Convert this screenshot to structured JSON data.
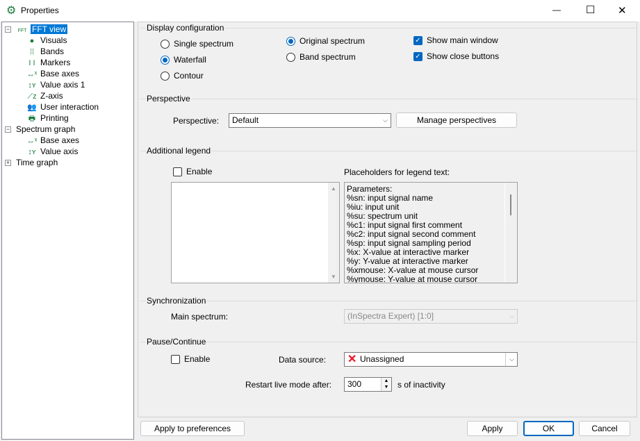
{
  "window": {
    "title": "Properties",
    "minimize": "—",
    "maximize": "☐",
    "close": "✕"
  },
  "tree": [
    {
      "label": "FFT view",
      "icon": "FFT",
      "level": 0,
      "expander": "−",
      "selected": true
    },
    {
      "label": "Visuals",
      "icon": "●",
      "level": 1
    },
    {
      "label": "Bands",
      "icon": "⁞⁞",
      "level": 1
    },
    {
      "label": "Markers",
      "icon": "I I",
      "level": 1
    },
    {
      "label": "Base axes",
      "icon": "↔ˣ",
      "level": 1
    },
    {
      "label": "Value axis 1",
      "icon": "↕ʏ",
      "level": 1
    },
    {
      "label": "Z-axis",
      "icon": "⟋z",
      "level": 1
    },
    {
      "label": "User interaction",
      "icon": "👥",
      "level": 1
    },
    {
      "label": "Printing",
      "icon": "🖶",
      "level": 1
    },
    {
      "label": "Spectrum graph",
      "level": 0,
      "expander": "−"
    },
    {
      "label": "Base axes",
      "icon": "↔ˣ",
      "level": 1
    },
    {
      "label": "Value axis",
      "icon": "↕ʏ",
      "level": 1
    },
    {
      "label": "Time graph",
      "level": 0,
      "expander": "+"
    }
  ],
  "display": {
    "title": "Display configuration",
    "single": "Single spectrum",
    "waterfall": "Waterfall",
    "contour": "Contour",
    "original": "Original spectrum",
    "band": "Band spectrum",
    "show_main": "Show main window",
    "show_close": "Show close buttons",
    "check": "✓"
  },
  "perspective": {
    "title": "Perspective",
    "label": "Perspective:",
    "value": "Default",
    "manage": "Manage perspectives"
  },
  "legend": {
    "title": "Additional legend",
    "enable": "Enable",
    "placeholders_label": "Placeholders for legend text:",
    "placeholders": [
      "Parameters:",
      "%sn: input signal name",
      "%iu: input unit",
      "%su: spectrum unit",
      "%c1: input signal first comment",
      "%c2: input signal second comment",
      "%sp: input signal sampling period",
      "%x: X-value at interactive marker",
      "%y: Y-value at interactive marker",
      "%xmouse: X-value at mouse cursor",
      "%ymouse: Y-value at mouse cursor"
    ]
  },
  "sync": {
    "title": "Synchronization",
    "label": "Main spectrum:",
    "value": "(InSpectra Expert) [1:0]"
  },
  "pause": {
    "title": "Pause/Continue",
    "enable": "Enable",
    "source_label": "Data source:",
    "source_value": "Unassigned",
    "restart_label": "Restart live mode after:",
    "restart_value": "300",
    "restart_unit": "s of inactivity"
  },
  "buttons": {
    "apply_prefs": "Apply to preferences",
    "apply": "Apply",
    "ok": "OK",
    "cancel": "Cancel"
  }
}
